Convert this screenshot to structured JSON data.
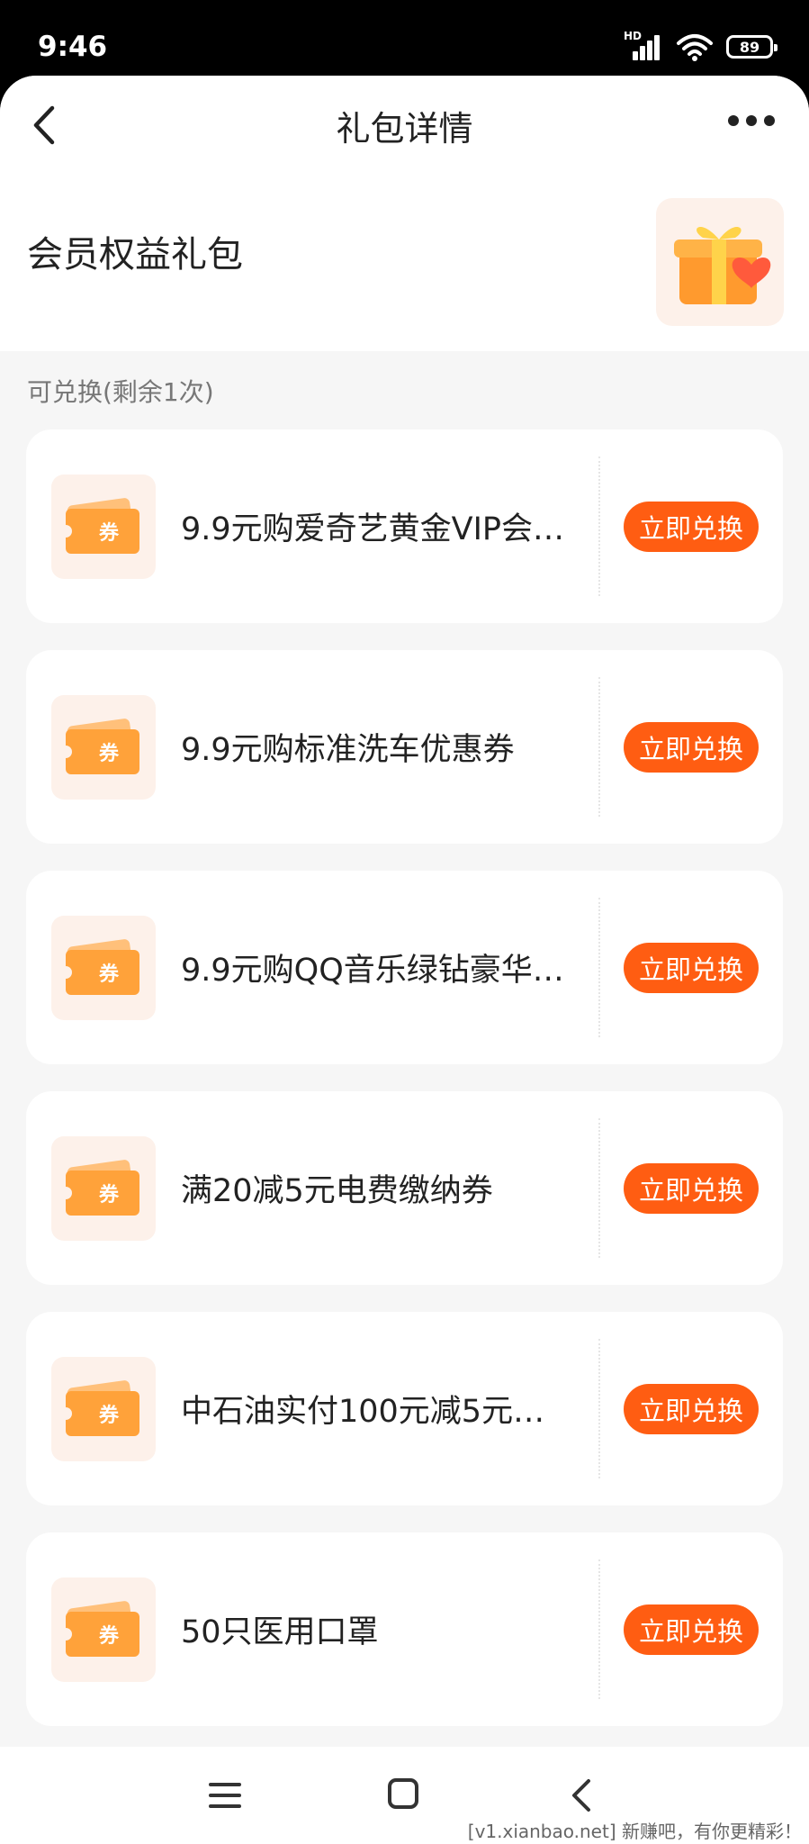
{
  "status_bar": {
    "time": "9:46",
    "network_badge": "HD",
    "battery": "89"
  },
  "header": {
    "title": "礼包详情"
  },
  "gift": {
    "title": "会员权益礼包",
    "image_icon": "gift-box-heart-icon"
  },
  "section": {
    "label": "可兑换(剩余1次)"
  },
  "coupon_icon": {
    "glyph": "券",
    "name": "coupon-ticket-icon"
  },
  "items": [
    {
      "title": "9.9元购爱奇艺黄金VIP会…",
      "button": "立即兑换"
    },
    {
      "title": "9.9元购标准洗车优惠券",
      "button": "立即兑换"
    },
    {
      "title": "9.9元购QQ音乐绿钻豪华…",
      "button": "立即兑换"
    },
    {
      "title": "满20减5元电费缴纳券",
      "button": "立即兑换"
    },
    {
      "title": "中石油实付100元减5元…",
      "button": "立即兑换"
    },
    {
      "title": "50只医用口罩",
      "button": "立即兑换"
    }
  ],
  "watermark": "[v1.xianbao.net] 新赚吧，有你更精彩！",
  "colors": {
    "accent": "#ff5d12",
    "background": "#f6f6f6",
    "icon_bg": "#fdf1ea",
    "coupon_orange": "#ffa23a"
  }
}
